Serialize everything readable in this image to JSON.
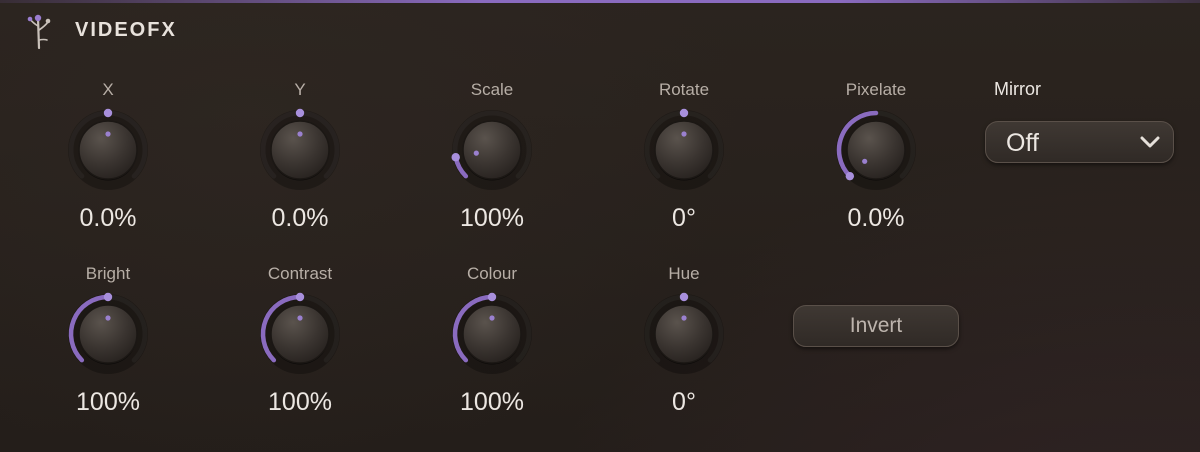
{
  "header": {
    "title": "VIDEOFX",
    "logo_icon": "plant-logo-icon"
  },
  "colors": {
    "accent": "#8a6bbf",
    "background": "#241e1a",
    "text": "#ece7e2",
    "label": "#b7aea6"
  },
  "knobs": [
    {
      "id": "x",
      "label": "X",
      "value": "0.0%",
      "level": 0.5
    },
    {
      "id": "y",
      "label": "Y",
      "value": "0.0%",
      "level": 0.5
    },
    {
      "id": "scale",
      "label": "Scale",
      "value": "100%",
      "level": 0.125
    },
    {
      "id": "rotate",
      "label": "Rotate",
      "value": "0°",
      "level": 0.5
    },
    {
      "id": "pixelate",
      "label": "Pixelate",
      "value": "0.0%",
      "level": 0
    },
    {
      "id": "bright",
      "label": "Bright",
      "value": "100%",
      "level": 0.5
    },
    {
      "id": "contrast",
      "label": "Contrast",
      "value": "100%",
      "level": 0.5
    },
    {
      "id": "colour",
      "label": "Colour",
      "value": "100%",
      "level": 0.5
    },
    {
      "id": "hue",
      "label": "Hue",
      "value": "0°",
      "level": 0.5
    }
  ],
  "mirror": {
    "label": "Mirror",
    "value": "Off",
    "icon": "chevron-down-icon"
  },
  "invert": {
    "label": "Invert"
  }
}
